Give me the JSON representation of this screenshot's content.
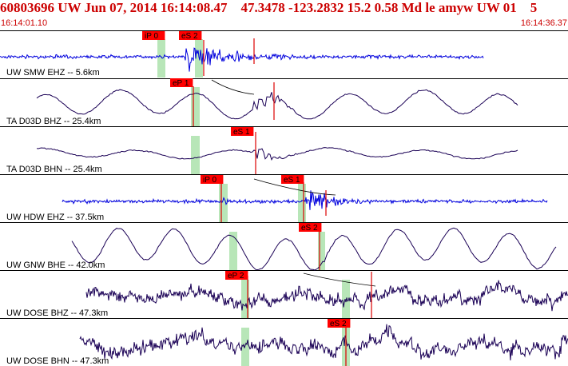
{
  "header": {
    "title": "60803696 UW Jun 07, 2014 16:14:08.47    47.3478 -123.2832 15.2 0.58 Md le amyw UW 01    5",
    "start_time": "16:14:01.10",
    "end_time": "16:14:36.37"
  },
  "traces": [
    {
      "label": "UW SMW EHZ -- 5.6km",
      "color": "#0000dd"
    },
    {
      "label": "TA D03D BHZ -- 25.4km",
      "color": "#1a0055"
    },
    {
      "label": "TA D03D BHN -- 25.4km",
      "color": "#1a0055"
    },
    {
      "label": "UW HDW EHZ -- 37.5km",
      "color": "#0000dd"
    },
    {
      "label": "UW GNW BHE -- 42.0km",
      "color": "#1a0055"
    },
    {
      "label": "UW DOSE BHZ -- 47.3km",
      "color": "#1a0055"
    },
    {
      "label": "UW DOSE BHN -- 47.3km",
      "color": "#1a0055"
    }
  ],
  "picks": [
    {
      "label": "iP 0",
      "trace": 0
    },
    {
      "label": "eS 2",
      "trace": 0
    },
    {
      "label": "eP 1",
      "trace": 1
    },
    {
      "label": "eS 1",
      "trace": 2
    },
    {
      "label": "iP 0",
      "trace": 3
    },
    {
      "label": "eS 1",
      "trace": 3
    },
    {
      "label": "eS 2",
      "trace": 4
    },
    {
      "label": "eP 2",
      "trace": 5
    },
    {
      "label": "eS 2",
      "trace": 6
    }
  ],
  "colors": {
    "title": "#cc0000",
    "pick_box": "#ff0000",
    "window_shade": "#b8e6b8",
    "separator": "#000000"
  }
}
